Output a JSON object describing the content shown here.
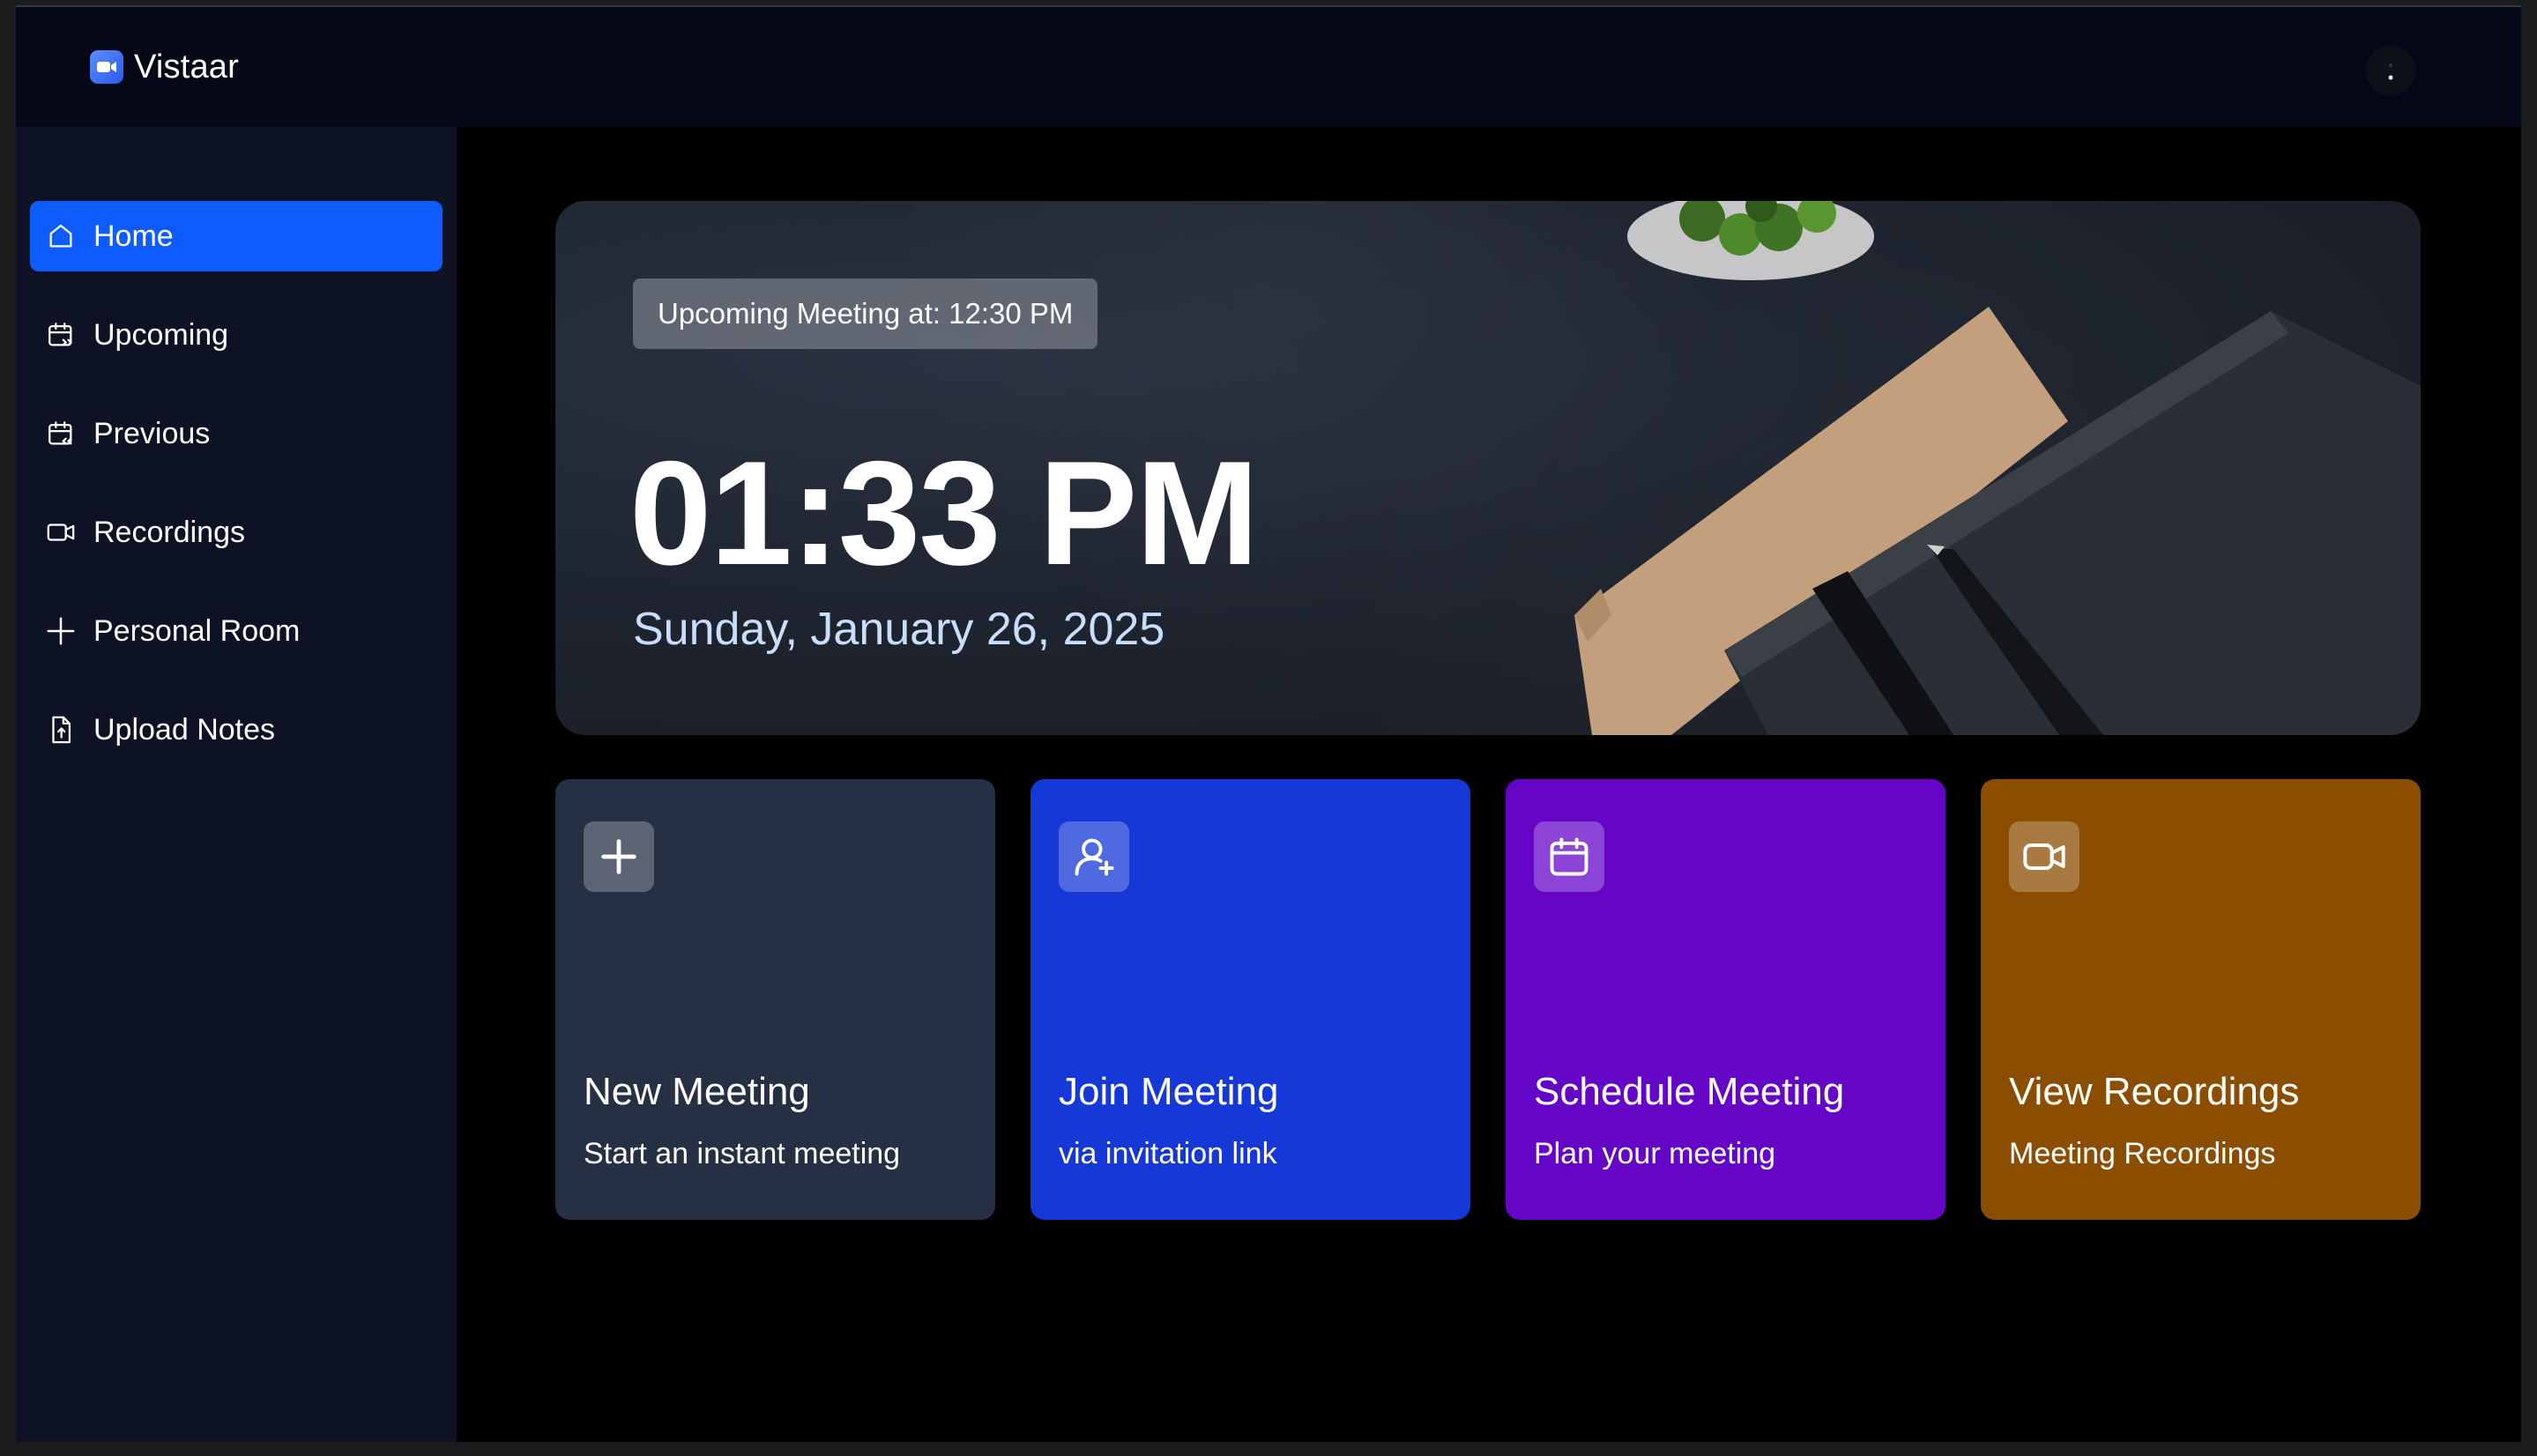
{
  "app": {
    "name": "Vistaar",
    "logo_icon": "video-camera-icon"
  },
  "sidebar": {
    "items": [
      {
        "label": "Home",
        "icon": "home-icon",
        "active": true
      },
      {
        "label": "Upcoming",
        "icon": "calendar-upcoming-icon",
        "active": false
      },
      {
        "label": "Previous",
        "icon": "calendar-previous-icon",
        "active": false
      },
      {
        "label": "Recordings",
        "icon": "video-icon",
        "active": false
      },
      {
        "label": "Personal Room",
        "icon": "plus-icon",
        "active": false
      },
      {
        "label": "Upload Notes",
        "icon": "file-upload-icon",
        "active": false
      }
    ]
  },
  "hero": {
    "upcoming": "Upcoming Meeting at: 12:30 PM",
    "time": "01:33 PM",
    "date": "Sunday, January 26, 2025"
  },
  "cards": [
    {
      "title": "New Meeting",
      "subtitle": "Start an instant meeting",
      "icon": "plus-icon",
      "color": "#263044"
    },
    {
      "title": "Join Meeting",
      "subtitle": "via invitation link",
      "icon": "user-plus-icon",
      "color": "#1538d6"
    },
    {
      "title": "Schedule Meeting",
      "subtitle": "Plan your meeting",
      "icon": "calendar-icon",
      "color": "#6506c7"
    },
    {
      "title": "View Recordings",
      "subtitle": "Meeting Recordings",
      "icon": "video-icon",
      "color": "#8b4d00"
    }
  ],
  "colors": {
    "accent": "#0e5cff",
    "topbar": "#050816",
    "sidebar": "#0d1324",
    "background": "#000000"
  }
}
